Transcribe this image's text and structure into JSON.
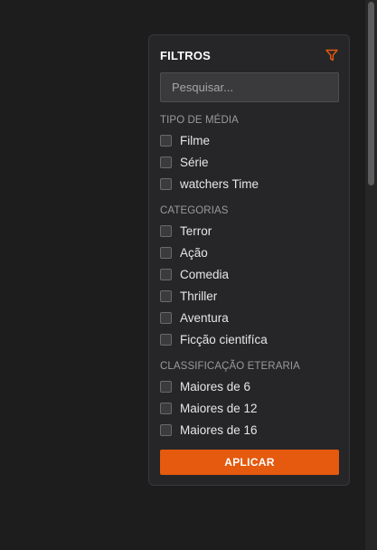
{
  "filters": {
    "title": "FILTROS",
    "filter_icon": "funnel-icon",
    "search": {
      "placeholder": "Pesquisar...",
      "value": ""
    },
    "sections": [
      {
        "title": "TIPO DE MÉDIA",
        "items": [
          "Filme",
          "Série",
          "watchers Time"
        ]
      },
      {
        "title": "CATEGORIAS",
        "items": [
          "Terror",
          "Ação",
          "Comedia",
          "Thriller",
          "Aventura",
          "Ficção cientifíca"
        ]
      },
      {
        "title": "CLASSIFICAÇÃO ETERARIA",
        "items": [
          "Maiores de 6",
          "Maiores de 12",
          "Maiores de 16"
        ]
      }
    ],
    "apply_label": "APLICAR"
  },
  "colors": {
    "background": "#1d1d1e",
    "panel": "#262628",
    "accent": "#e55a0e"
  }
}
